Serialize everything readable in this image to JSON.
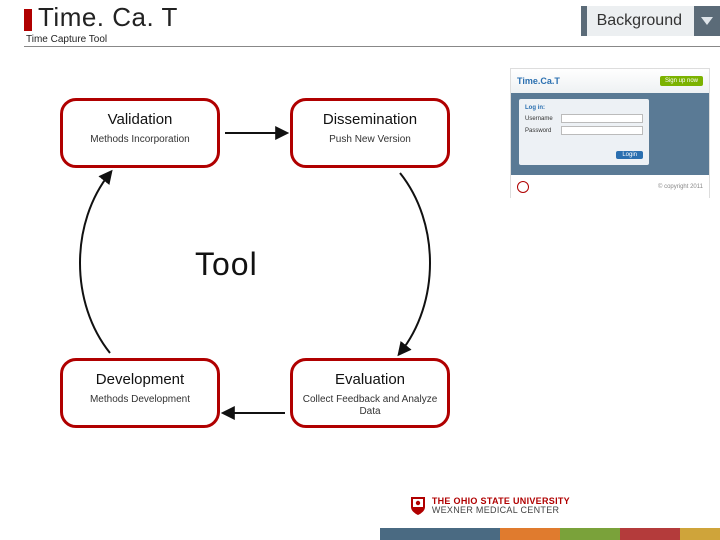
{
  "header": {
    "title": "Time. Ca. T",
    "subtitle": "Time Capture Tool",
    "chip_label": "Background"
  },
  "diagram": {
    "center": "Tool",
    "nodes": {
      "validation": {
        "title": "Validation",
        "sub": "Methods Incorporation"
      },
      "dissemination": {
        "title": "Dissemination",
        "sub": "Push New Version"
      },
      "development": {
        "title": "Development",
        "sub": "Methods Development"
      },
      "evaluation": {
        "title": "Evaluation",
        "sub": "Collect Feedback and Analyze Data"
      }
    }
  },
  "screenshot": {
    "brand": "Time.Ca.T",
    "signup": "Sign up now",
    "login_header": "Log in:",
    "username_label": "Username",
    "password_label": "Password",
    "login_button": "Login",
    "copyright": "© copyright 2011"
  },
  "footer": {
    "org_line1": "THE OHIO STATE UNIVERSITY",
    "org_line2": "WEXNER MEDICAL CENTER"
  }
}
